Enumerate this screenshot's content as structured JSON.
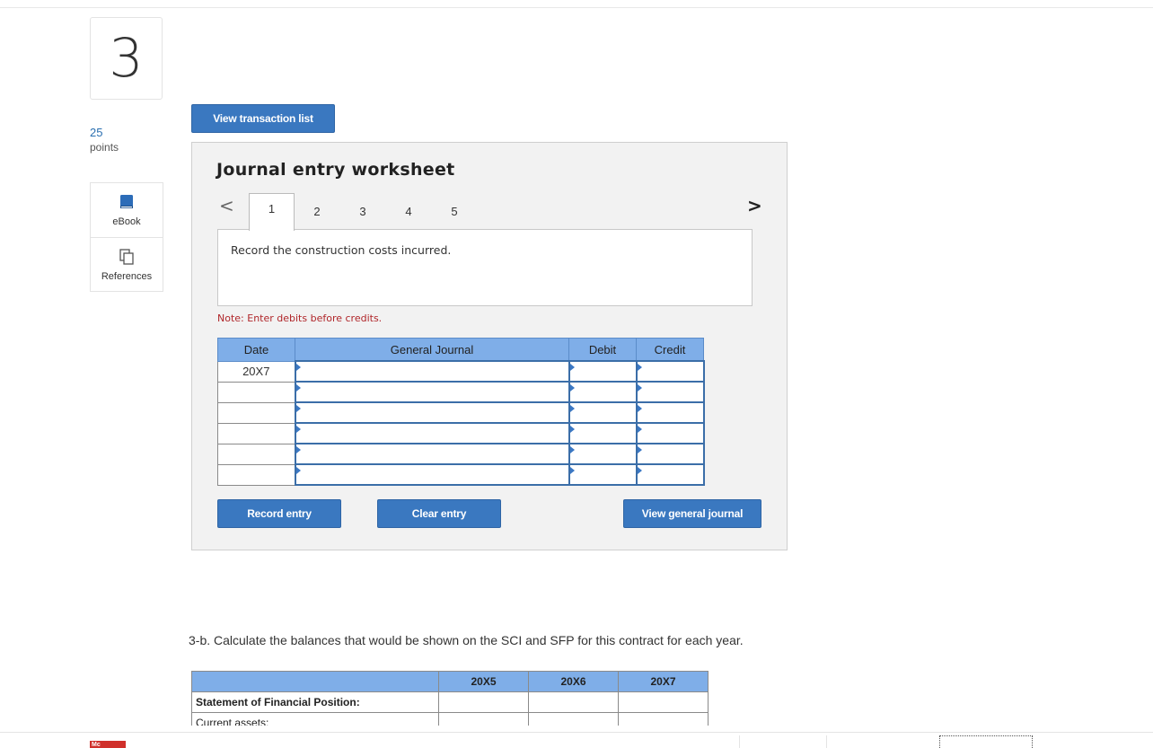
{
  "question": {
    "number": "3",
    "points_value": "25",
    "points_label": "points"
  },
  "sidebar": {
    "items": [
      {
        "label": "eBook",
        "icon": "book-icon"
      },
      {
        "label": "References",
        "icon": "copy-pages-icon"
      }
    ]
  },
  "buttons": {
    "view_transactions": "View transaction list",
    "record_entry": "Record entry",
    "clear_entry": "Clear entry",
    "view_general_journal": "View general journal"
  },
  "worksheet": {
    "title": "Journal entry worksheet",
    "prev_arrow": "<",
    "next_arrow": ">",
    "tabs": [
      "1",
      "2",
      "3",
      "4",
      "5"
    ],
    "active_tab": "1",
    "description": "Record the construction costs incurred.",
    "note": "Note: Enter debits before credits.",
    "columns": [
      "Date",
      "General Journal",
      "Debit",
      "Credit"
    ],
    "rows": [
      {
        "date": "20X7",
        "account": "",
        "debit": "",
        "credit": ""
      },
      {
        "date": "",
        "account": "",
        "debit": "",
        "credit": ""
      },
      {
        "date": "",
        "account": "",
        "debit": "",
        "credit": ""
      },
      {
        "date": "",
        "account": "",
        "debit": "",
        "credit": ""
      },
      {
        "date": "",
        "account": "",
        "debit": "",
        "credit": ""
      },
      {
        "date": "",
        "account": "",
        "debit": "",
        "credit": ""
      }
    ]
  },
  "part_3b": {
    "prompt": "3-b. Calculate the balances that would be shown on the SCI and SFP for this contract for each year.",
    "columns": [
      "",
      "20X5",
      "20X6",
      "20X7"
    ],
    "rows": [
      {
        "label": "Statement of Financial Position:",
        "bold": true
      },
      {
        "label": "Current assets:",
        "bold": false
      }
    ]
  },
  "footer": {
    "logo_text": "Mc"
  },
  "colors": {
    "accent_button": "#3a78c0",
    "table_header": "#7faee8",
    "note_red": "#b0262a",
    "points_blue": "#2a6fb0"
  }
}
